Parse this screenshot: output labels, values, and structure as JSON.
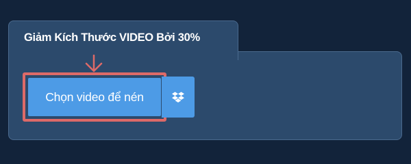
{
  "tab": {
    "title": "Giảm Kích Thước VIDEO Bởi 30%"
  },
  "upload": {
    "choose_label": "Chọn video để nén",
    "dropbox_icon": "dropbox-icon",
    "pointer_icon": "down-arrow-icon"
  },
  "colors": {
    "background": "#12233a",
    "panel": "#2c4a6c",
    "button": "#4d9be6",
    "highlight": "#dd6a68"
  }
}
